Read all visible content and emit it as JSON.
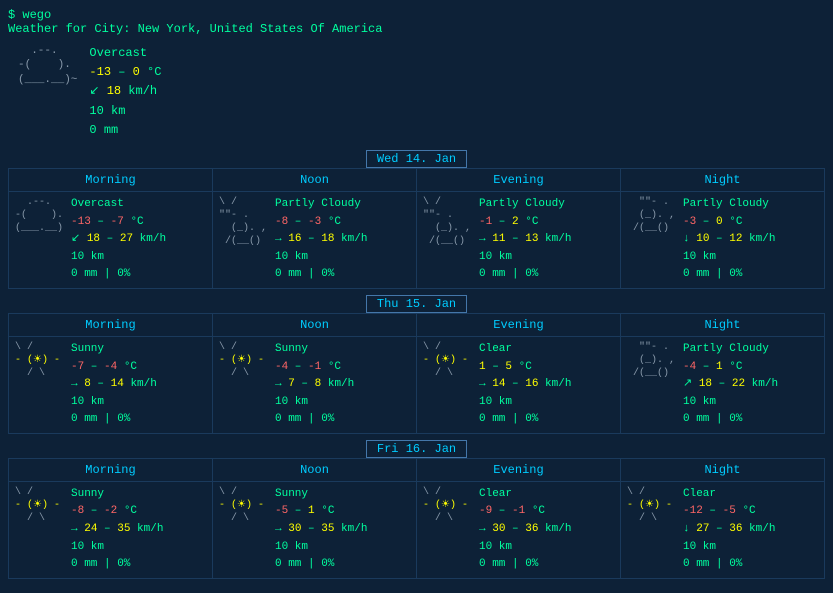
{
  "app": {
    "name": "$ wego",
    "location_label": "Weather for City: New York, United States Of America"
  },
  "current": {
    "condition": "Overcast",
    "temp_low": "-13",
    "temp_high": "0",
    "temp_unit": "°C",
    "wind_arrow": "↙",
    "wind_val": "18",
    "wind_unit": "km/h",
    "visibility": "10 km",
    "precipitation": "0 mm"
  },
  "days": [
    {
      "label": "Wed 14. Jan",
      "periods": [
        {
          "name": "Morning",
          "condition": "Overcast",
          "temp_low": "-13",
          "temp_high": "-7",
          "temp_unit": "°C",
          "wind_arrow": "↙",
          "wind_low": "18",
          "wind_high": "27",
          "wind_unit": "km/h",
          "visibility": "10 km",
          "precip": "0 mm | 0%",
          "icon_type": "cloud",
          "icon": "  .--.\n-(    ).\n(___.__)~\n         "
        },
        {
          "name": "Noon",
          "condition": "Partly Cloudy",
          "temp_low": "-8",
          "temp_high": "-3",
          "temp_unit": "°C",
          "wind_arrow": "→",
          "wind_low": "16",
          "wind_high": "18",
          "wind_unit": "km/h",
          "visibility": "10 km",
          "precip": "0 mm | 0%",
          "icon_type": "partly",
          "icon": "\\ /\n\"\"- .\n  (_). ,\n /(__()"
        },
        {
          "name": "Evening",
          "condition": "Partly Cloudy",
          "temp_low": "-1",
          "temp_high": "2",
          "temp_unit": "°C",
          "wind_arrow": "→",
          "wind_low": "11",
          "wind_high": "13",
          "wind_unit": "km/h",
          "visibility": "10 km",
          "precip": "0 mm | 0%",
          "icon_type": "partly",
          "icon": "\\ /\n\"\"- .\n  (_). ,\n /(__()"
        },
        {
          "name": "Night",
          "condition": "Partly Cloudy",
          "temp_low": "-3",
          "temp_high": "0",
          "temp_unit": "°C",
          "wind_arrow": "↓",
          "wind_low": "10",
          "wind_high": "12",
          "wind_unit": "km/h",
          "visibility": "10 km",
          "precip": "0 mm | 0%",
          "icon_type": "night_partly",
          "icon": "  \"\"- .\n  (_). ,\n /(__()"
        }
      ]
    },
    {
      "label": "Thu 15. Jan",
      "periods": [
        {
          "name": "Morning",
          "condition": "Sunny",
          "temp_low": "-7",
          "temp_high": "-4",
          "temp_unit": "°C",
          "wind_arrow": "→",
          "wind_low": "8",
          "wind_high": "14",
          "wind_unit": "km/h",
          "visibility": "10 km",
          "precip": "0 mm | 0%",
          "icon_type": "sun",
          "icon": "\\ /\n- ( ) -\n  / \\"
        },
        {
          "name": "Noon",
          "condition": "Sunny",
          "temp_low": "-4",
          "temp_high": "-1",
          "temp_unit": "°C",
          "wind_arrow": "→",
          "wind_low": "7",
          "wind_high": "8",
          "wind_unit": "km/h",
          "visibility": "10 km",
          "precip": "0 mm | 0%",
          "icon_type": "sun",
          "icon": "\\ /\n- ( ) -\n  / \\"
        },
        {
          "name": "Evening",
          "condition": "Clear",
          "temp_low": "1",
          "temp_high": "5",
          "temp_unit": "°C",
          "wind_arrow": "→",
          "wind_low": "14",
          "wind_high": "16",
          "wind_unit": "km/h",
          "visibility": "10 km",
          "precip": "0 mm | 0%",
          "icon_type": "sun",
          "icon": "\\ /\n- ( ) -\n  / \\"
        },
        {
          "name": "Night",
          "condition": "Partly Cloudy",
          "temp_low": "-4",
          "temp_high": "1",
          "temp_unit": "°C",
          "wind_arrow": "↗",
          "wind_low": "18",
          "wind_high": "22",
          "wind_unit": "km/h",
          "visibility": "10 km",
          "precip": "0 mm | 0%",
          "icon_type": "night_partly",
          "icon": "  \"\"- .\n  (_). ,\n /(__()"
        }
      ]
    },
    {
      "label": "Fri 16. Jan",
      "periods": [
        {
          "name": "Morning",
          "condition": "Sunny",
          "temp_low": "-8",
          "temp_high": "-2",
          "temp_unit": "°C",
          "wind_arrow": "→",
          "wind_low": "24",
          "wind_high": "35",
          "wind_unit": "km/h",
          "visibility": "10 km",
          "precip": "0 mm | 0%",
          "icon_type": "sun",
          "icon": "\\ /\n- ( ) -\n  / \\"
        },
        {
          "name": "Noon",
          "condition": "Sunny",
          "temp_low": "-5",
          "temp_high": "1",
          "temp_unit": "°C",
          "wind_arrow": "→",
          "wind_low": "30",
          "wind_high": "35",
          "wind_unit": "km/h",
          "visibility": "10 km",
          "precip": "0 mm | 0%",
          "icon_type": "sun",
          "icon": "\\ /\n- ( ) -\n  / \\"
        },
        {
          "name": "Evening",
          "condition": "Clear",
          "temp_low": "-9",
          "temp_high": "-1",
          "temp_unit": "°C",
          "wind_arrow": "→",
          "wind_low": "30",
          "wind_high": "36",
          "wind_unit": "km/h",
          "visibility": "10 km",
          "precip": "0 mm | 0%",
          "icon_type": "sun",
          "icon": "\\ /\n- ( ) -\n  / \\"
        },
        {
          "name": "Night",
          "condition": "Clear",
          "temp_low": "-12",
          "temp_high": "-5",
          "temp_unit": "°C",
          "wind_arrow": "↓",
          "wind_low": "27",
          "wind_high": "36",
          "wind_unit": "km/h",
          "visibility": "10 km",
          "precip": "0 mm | 0%",
          "icon_type": "sun",
          "icon": "\\ /\n- ( ) -\n  / \\"
        }
      ]
    }
  ]
}
